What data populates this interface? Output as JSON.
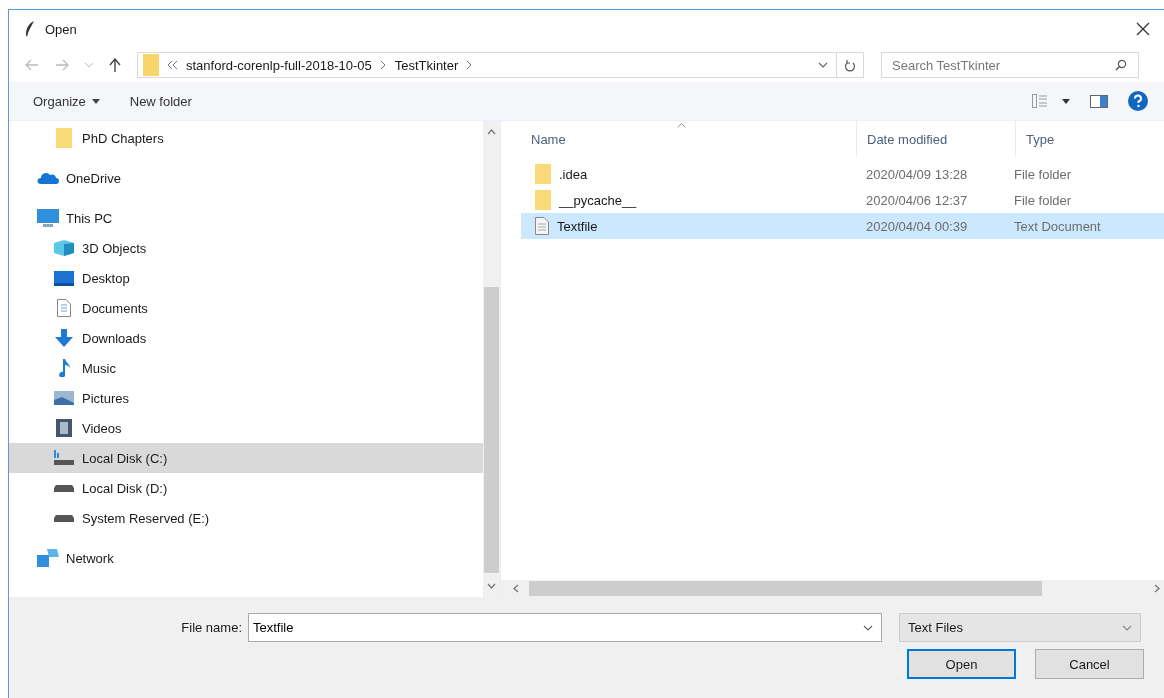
{
  "window": {
    "title": "Open"
  },
  "address_bar": {
    "path": [
      "stanford-corenlp-full-2018-10-05",
      "TestTkinter"
    ]
  },
  "search": {
    "placeholder": "Search TestTkinter"
  },
  "toolbar": {
    "organize": "Organize",
    "new_folder": "New folder"
  },
  "nav": [
    {
      "children": [
        {
          "label": "PhD Chapters",
          "kind": "folder",
          "selected": false
        }
      ]
    },
    {
      "label": "OneDrive",
      "kind": "cloud",
      "selected": false
    },
    {
      "label": "This PC",
      "kind": "pc",
      "selected": false,
      "children": [
        {
          "label": "3D Objects",
          "kind": "cube",
          "selected": false
        },
        {
          "label": "Desktop",
          "kind": "desktop",
          "selected": false
        },
        {
          "label": "Documents",
          "kind": "document",
          "selected": false
        },
        {
          "label": "Downloads",
          "kind": "download",
          "selected": false
        },
        {
          "label": "Music",
          "kind": "music",
          "selected": false
        },
        {
          "label": "Pictures",
          "kind": "pictures",
          "selected": false
        },
        {
          "label": "Videos",
          "kind": "video",
          "selected": false
        },
        {
          "label": "Local Disk (C:)",
          "kind": "system-drive",
          "selected": true
        },
        {
          "label": "Local Disk (D:)",
          "kind": "drive",
          "selected": false
        },
        {
          "label": "System Reserved (E:)",
          "kind": "drive",
          "selected": false
        }
      ]
    },
    {
      "label": "Network",
      "kind": "network",
      "selected": false
    }
  ],
  "files": {
    "columns": [
      "Name",
      "Date modified",
      "Type"
    ],
    "rows": [
      {
        "name": ".idea",
        "date": "2020/04/09 13:28",
        "type": "File folder",
        "kind": "folder",
        "selected": false
      },
      {
        "name": "__pycache__",
        "date": "2020/04/06 12:37",
        "type": "File folder",
        "kind": "folder",
        "selected": false
      },
      {
        "name": "Textfile",
        "date": "2020/04/04 00:39",
        "type": "Text Document",
        "kind": "text",
        "selected": true
      }
    ]
  },
  "file_name": {
    "label": "File name:",
    "value": "Textfile"
  },
  "file_type": {
    "value": "Text Files"
  },
  "buttons": [
    {
      "label": "Open",
      "kind": "default"
    },
    {
      "label": "Cancel",
      "kind": "normal"
    }
  ]
}
